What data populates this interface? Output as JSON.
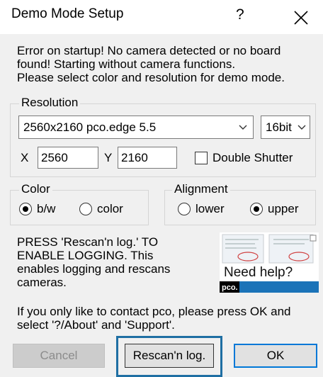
{
  "window": {
    "title": "Demo Mode Setup",
    "help_glyph": "?"
  },
  "message": [
    "Error on startup! No camera detected or no board",
    "found! Starting without camera functions.",
    "Please select color and resolution for demo mode."
  ],
  "resolution": {
    "legend": "Resolution",
    "camera_combo": "2560x2160 pco.edge 5.5",
    "bitdepth_combo": "16bit",
    "x_label": "X",
    "x_value": "2560",
    "y_label": "Y",
    "y_value": "2160",
    "double_shutter_label": "Double Shutter",
    "double_shutter_checked": false
  },
  "color": {
    "legend": "Color",
    "options": [
      {
        "label": "b/w",
        "selected": true
      },
      {
        "label": "color",
        "selected": false
      }
    ]
  },
  "alignment": {
    "legend": "Alignment",
    "options": [
      {
        "label": "lower",
        "selected": false
      },
      {
        "label": "upper",
        "selected": true
      }
    ]
  },
  "press_text": [
    "PRESS 'Rescan'n log.' TO",
    "ENABLE LOGGING. This",
    "enables logging and rescans",
    "cameras."
  ],
  "help_image": {
    "caption": "Need help?",
    "brand": "pco."
  },
  "footer_text": [
    "If you only like to contact pco, please press OK and",
    "select '?/About' and 'Support'."
  ],
  "buttons": {
    "cancel": "Cancel",
    "rescan": "Rescan'n log.",
    "ok": "OK"
  },
  "colors": {
    "focus_highlight": "#1f6fa3",
    "default_button_border": "#0078d7"
  }
}
